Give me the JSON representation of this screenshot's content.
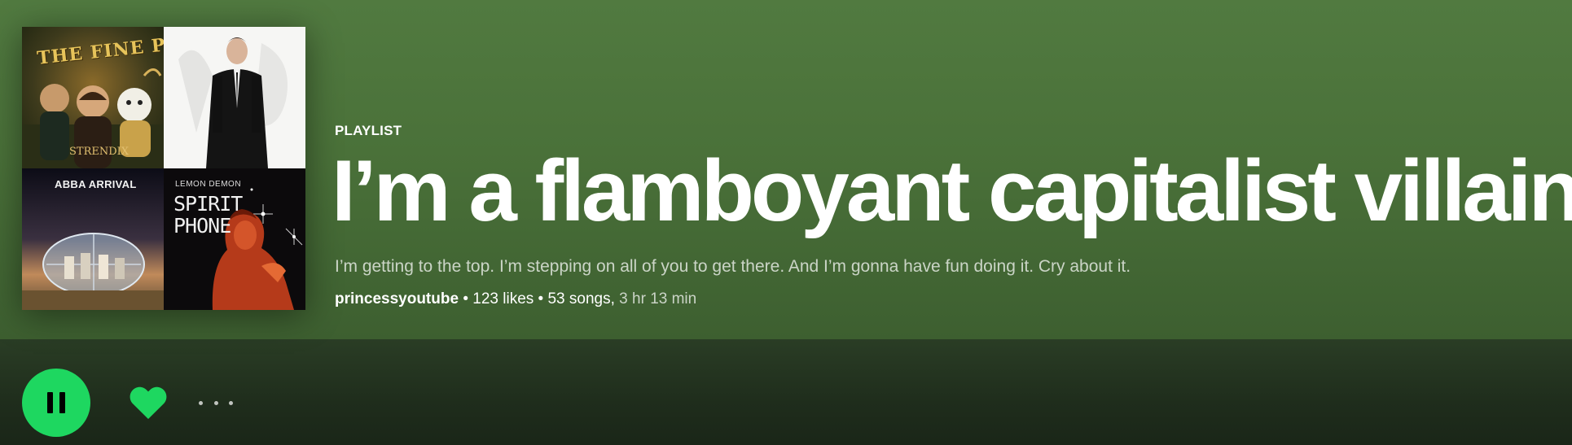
{
  "playlist": {
    "type_label": "PLAYLIST",
    "title": "I’m a flamboyant capitalist villain.",
    "description": "I’m getting to the top. I’m stepping on all of you to get there. And I’m gonna have fun doing it. Cry about it.",
    "owner": "princessyoutube",
    "separator": " • ",
    "likes": "123 likes",
    "songs": "53 songs,",
    "duration": "3 hr 13 min"
  },
  "cover": {
    "tiles": [
      {
        "name": "the-fine-print-cover",
        "text_top": "THE FINE PRINT",
        "text_bottom": "STRENDIX"
      },
      {
        "name": "suited-man-cover",
        "text_top": ""
      },
      {
        "name": "abba-arrival-cover",
        "text_top": "ABBA  ARRIVAL"
      },
      {
        "name": "lemon-demon-spirit-phone-cover",
        "text_top": "LEMON DEMON",
        "text_bottom": "SPIRIT PHONE"
      }
    ]
  },
  "actions": {
    "play_state": "playing",
    "play_icon": "pause-icon",
    "like_icon": "heart-filled-icon",
    "more_icon": "ellipsis-icon"
  },
  "colors": {
    "accent": "#1ed760",
    "header_bg": "#4e773d",
    "text": "#ffffff"
  }
}
